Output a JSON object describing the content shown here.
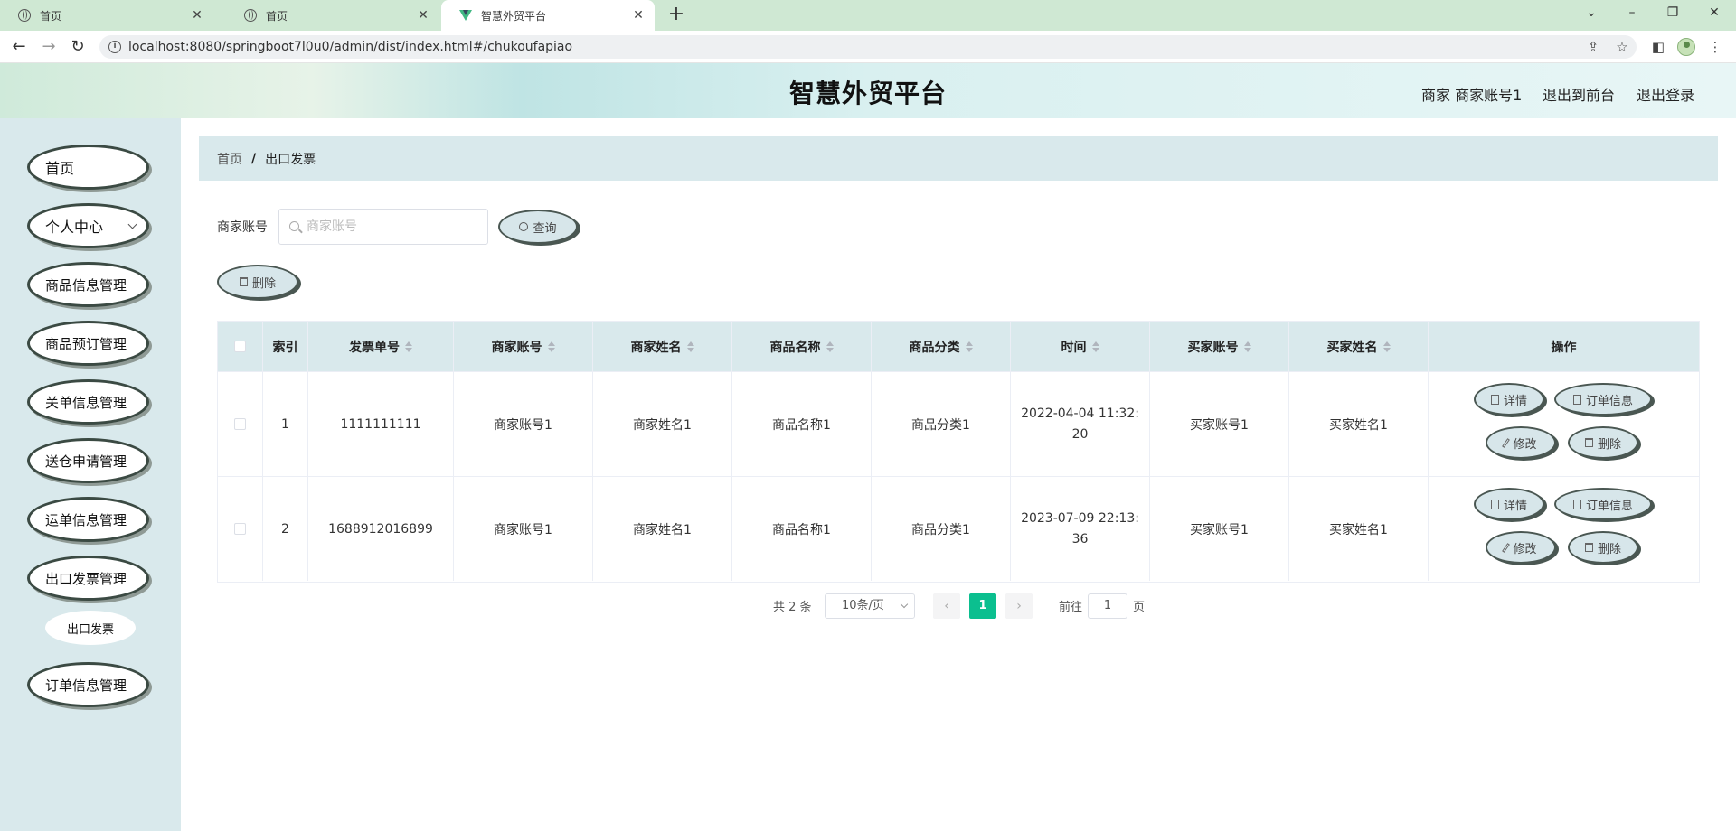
{
  "browser": {
    "tabs": [
      {
        "title": "首页"
      },
      {
        "title": "首页"
      },
      {
        "title": "智慧外贸平台"
      }
    ],
    "url": "localhost:8080/springboot7l0u0/admin/dist/index.html#/chukoufapiao"
  },
  "header": {
    "title": "智慧外贸平台",
    "user": "商家 商家账号1",
    "to_front": "退出到前台",
    "logout": "退出登录"
  },
  "sidebar": {
    "items": [
      {
        "label": "首页"
      },
      {
        "label": "个人中心"
      },
      {
        "label": "商品信息管理"
      },
      {
        "label": "商品预订管理"
      },
      {
        "label": "关单信息管理"
      },
      {
        "label": "送仓申请管理"
      },
      {
        "label": "运单信息管理"
      },
      {
        "label": "出口发票管理"
      },
      {
        "label": "订单信息管理"
      }
    ],
    "submenu_label": "出口发票"
  },
  "breadcrumb": {
    "home": "首页",
    "sep": "/",
    "current": "出口发票"
  },
  "search": {
    "label": "商家账号",
    "placeholder": "商家账号",
    "button": "查询"
  },
  "toolbar": {
    "delete": "删除"
  },
  "table": {
    "columns": [
      "索引",
      "发票单号",
      "商家账号",
      "商家姓名",
      "商品名称",
      "商品分类",
      "时间",
      "买家账号",
      "买家姓名",
      "操作"
    ],
    "rows": [
      {
        "index": "1",
        "invoice_no": "1111111111",
        "merchant_account": "商家账号1",
        "merchant_name": "商家姓名1",
        "product_name": "商品名称1",
        "category": "商品分类1",
        "time": "2022-04-04 11:32:20",
        "buyer_account": "买家账号1",
        "buyer_name": "买家姓名1"
      },
      {
        "index": "2",
        "invoice_no": "1688912016899",
        "merchant_account": "商家账号1",
        "merchant_name": "商家姓名1",
        "product_name": "商品名称1",
        "category": "商品分类1",
        "time": "2023-07-09 22:13:36",
        "buyer_account": "买家账号1",
        "buyer_name": "买家姓名1"
      }
    ],
    "actions": {
      "detail": "详情",
      "order": "订单信息",
      "edit": "修改",
      "delete": "删除"
    }
  },
  "pagination": {
    "total": "共 2 条",
    "page_size": "10条/页",
    "current": "1",
    "goto_label": "前往",
    "goto_value": "1",
    "page_suffix": "页"
  },
  "colors": {
    "accent": "#0bbf8f",
    "panel": "#d9e9ec"
  }
}
